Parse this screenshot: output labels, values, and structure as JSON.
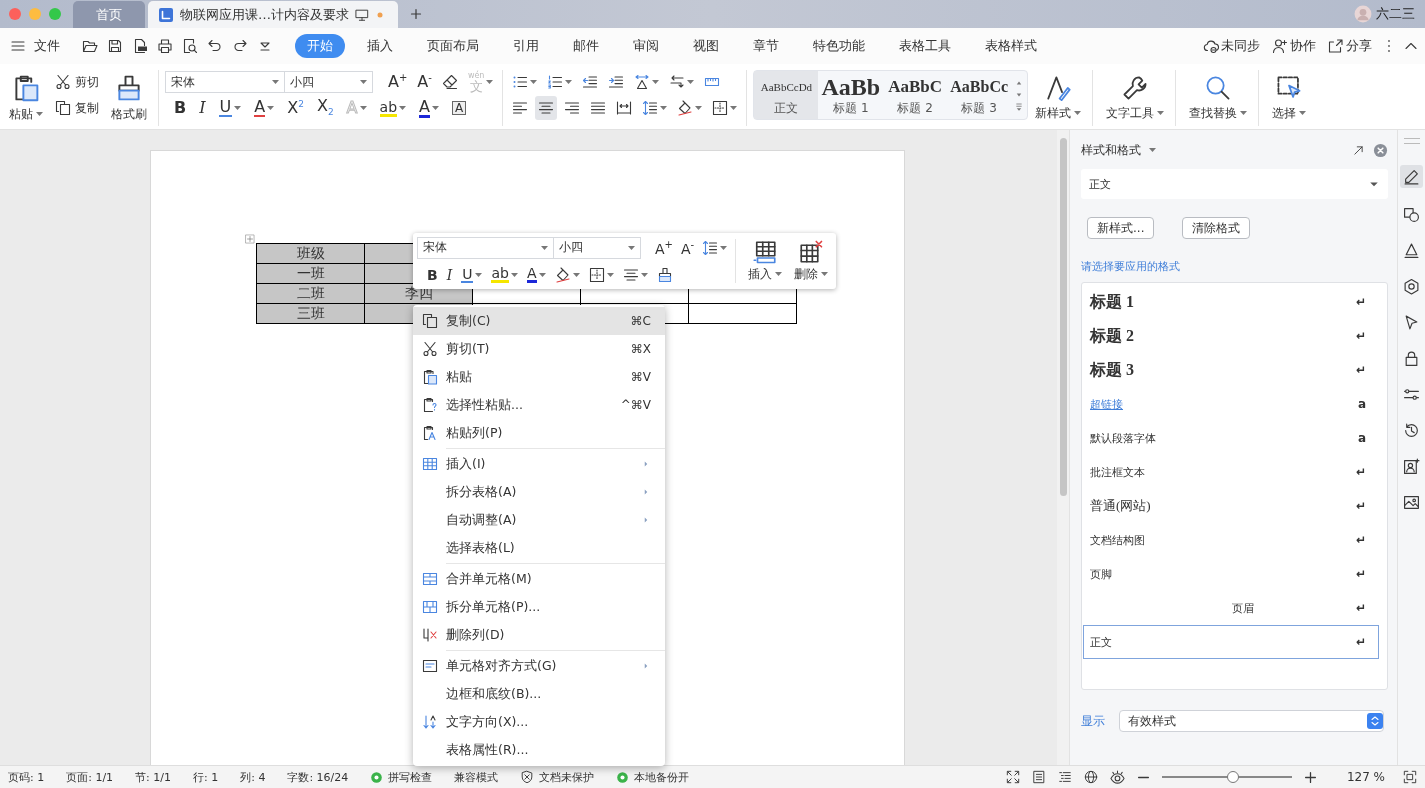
{
  "title_bar": {
    "tabs": [
      {
        "label": "首页",
        "kind": "home",
        "selected": false,
        "unsaved": false
      },
      {
        "label": "物联网应用课…计内容及要求",
        "kind": "document",
        "selected": true,
        "unsaved": true
      }
    ],
    "user": "六二三"
  },
  "menu_bar": {
    "file": "文件",
    "tabs": [
      {
        "label": "开始",
        "selected": true
      },
      {
        "label": "插入",
        "selected": false
      },
      {
        "label": "页面布局",
        "selected": false
      },
      {
        "label": "引用",
        "selected": false
      },
      {
        "label": "邮件",
        "selected": false
      },
      {
        "label": "审阅",
        "selected": false
      },
      {
        "label": "视图",
        "selected": false
      },
      {
        "label": "章节",
        "selected": false
      },
      {
        "label": "特色功能",
        "selected": false
      },
      {
        "label": "表格工具",
        "selected": false
      },
      {
        "label": "表格样式",
        "selected": false
      }
    ],
    "actions": [
      "未同步",
      "协作",
      "分享"
    ]
  },
  "ribbon": {
    "clipboard": {
      "paste": "粘贴",
      "cut": "剪切",
      "copy": "复制",
      "painter": "格式刷"
    },
    "font": {
      "name": "宋体",
      "size": "小四",
      "buttons": [
        {
          "text": "A$^{+}$",
          "kind": "grow",
          "disabled": false
        },
        {
          "text": "A$^{-}$",
          "kind": "shrink",
          "disabled": false
        },
        {
          "text": "文",
          "ruby": "wén",
          "kind": "phonetic",
          "disabled": true
        },
        {
          "text": "B",
          "kind": "bold",
          "disabled": false
        },
        {
          "text": "I",
          "kind": "italic",
          "disabled": false
        },
        {
          "text": "U",
          "kind": "underline",
          "disabled": false
        },
        {
          "text": "A",
          "kind": "strike",
          "disabled": false
        },
        {
          "text": "X$^{2}$",
          "kind": "superscript",
          "disabled": false
        },
        {
          "text": "X$_{2}$",
          "kind": "subscript",
          "disabled": false
        },
        {
          "text": "A",
          "kind": "outline",
          "disabled": true
        },
        {
          "text": "ab",
          "kind": "highlight",
          "disabled": false
        },
        {
          "text": "A",
          "kind": "color",
          "disabled": false
        },
        {
          "text": "A",
          "kind": "charborder",
          "disabled": false
        }
      ]
    },
    "paragraph": {
      "align_buttons": [
        {
          "selected": false
        },
        {
          "selected": true
        },
        {
          "selected": false
        },
        {
          "selected": false
        },
        {
          "selected": false
        }
      ]
    },
    "style_gallery": [
      {
        "preview": "AaBbCcDd",
        "label": "正文",
        "kind": "body",
        "selected": true
      },
      {
        "preview": "AaBb",
        "label": "标题 1",
        "kind": "heading1",
        "selected": false
      },
      {
        "preview": "AaBbC",
        "label": "标题 2",
        "kind": "heading2",
        "selected": false
      },
      {
        "preview": "AaBbCc",
        "label": "标题 3",
        "kind": "heading3",
        "selected": false
      }
    ],
    "tools": [
      "新样式",
      "文字工具",
      "查找替换",
      "选择"
    ]
  },
  "document": {
    "table": {
      "rows": [
        {
          "cells": [
            {
              "text": "班级",
              "shaded": true
            },
            {
              "shaded": true
            }
          ]
        },
        {
          "cells": [
            {
              "text": "一班",
              "shaded": true
            },
            {
              "shaded": true
            }
          ]
        },
        {
          "cells": [
            {
              "text": "二班",
              "shaded": true
            },
            {
              "text": "李四",
              "shaded": true
            },
            {
              "shaded": false
            },
            {
              "shaded": false
            },
            {
              "shaded": false
            }
          ]
        },
        {
          "cells": [
            {
              "text": "三班",
              "shaded": true
            },
            {
              "shaded": true
            },
            {
              "shaded": false
            },
            {
              "shaded": false
            },
            {
              "shaded": false
            }
          ]
        }
      ]
    }
  },
  "mini_toolbar": {
    "font": "宋体",
    "size": "小四",
    "buttons": [
      {
        "text": "A$^{+}$",
        "kind": "grow"
      },
      {
        "text": "A$^{-}$",
        "kind": "shrink"
      },
      {
        "text": "B",
        "kind": "bold"
      },
      {
        "text": "I",
        "kind": "italic"
      },
      {
        "text": "U",
        "kind": "underline"
      },
      {
        "text": "ab",
        "kind": "highlight"
      },
      {
        "text": "A",
        "kind": "color"
      }
    ],
    "insert": "插入",
    "delete": "删除"
  },
  "context_menu": {
    "groups": [
      [
        {
          "label": "复制(C)",
          "shortcut": "⌘C",
          "submenu": false,
          "selected": true
        },
        {
          "label": "剪切(T)",
          "shortcut": "⌘X",
          "submenu": false,
          "selected": false
        },
        {
          "label": "粘贴",
          "shortcut": "⌘V",
          "submenu": false,
          "selected": false
        },
        {
          "label": "选择性粘贴...",
          "shortcut": "^⌘V",
          "submenu": false,
          "selected": false
        },
        {
          "label": "粘贴列(P)",
          "submenu": false,
          "selected": false
        }
      ],
      [
        {
          "label": "插入(I)",
          "submenu": true,
          "selected": false
        },
        {
          "label": "拆分表格(A)",
          "submenu": true,
          "selected": false
        },
        {
          "label": "自动调整(A)",
          "submenu": true,
          "selected": false
        },
        {
          "label": "选择表格(L)",
          "submenu": false,
          "selected": false
        }
      ],
      [
        {
          "label": "合并单元格(M)",
          "submenu": false,
          "selected": false
        },
        {
          "label": "拆分单元格(P)...",
          "submenu": false,
          "selected": false
        },
        {
          "label": "删除列(D)",
          "submenu": false,
          "selected": false
        }
      ],
      [
        {
          "label": "单元格对齐方式(G)",
          "submenu": true,
          "selected": false
        },
        {
          "label": "边框和底纹(B)...",
          "submenu": false,
          "selected": false
        },
        {
          "label": "文字方向(X)...",
          "submenu": false,
          "selected": false
        },
        {
          "label": "表格属性(R)...",
          "submenu": false,
          "selected": false
        }
      ]
    ]
  },
  "styles_panel": {
    "title": "样式和格式",
    "current_style": "正文",
    "buttons": [
      "新样式...",
      "清除格式"
    ],
    "prompt": "请选择要应用的格式",
    "styles": [
      {
        "label": "标题 1",
        "kind": "heading",
        "symbol": "↵",
        "selected": false
      },
      {
        "label": "标题 2",
        "kind": "heading",
        "symbol": "↵",
        "selected": false
      },
      {
        "label": "标题 3",
        "kind": "heading",
        "symbol": "↵",
        "selected": false
      },
      {
        "label": "超链接",
        "kind": "hyperlink",
        "symbol": "a",
        "selected": false
      },
      {
        "label": "默认段落字体",
        "kind": "small",
        "symbol": "a",
        "selected": false
      },
      {
        "label": "批注框文本",
        "kind": "small",
        "symbol": "↵",
        "selected": false
      },
      {
        "label": "普通(网站)",
        "kind": "large",
        "symbol": "↵",
        "selected": false
      },
      {
        "label": "文档结构图",
        "kind": "medium",
        "symbol": "↵",
        "selected": false
      },
      {
        "label": "页脚",
        "kind": "tiny",
        "symbol": "↵",
        "selected": false
      },
      {
        "label": "页眉",
        "kind": "centered",
        "symbol": "↵",
        "selected": false
      },
      {
        "label": "正文",
        "kind": "medium",
        "symbol": "↵",
        "selected": true
      }
    ],
    "show_label": "显示",
    "show_value": "有效样式"
  },
  "status_bar": {
    "items": [
      {
        "text": "页码: 1",
        "kind": "plain"
      },
      {
        "text": "页面: 1/1",
        "kind": "plain"
      },
      {
        "text": "节: 1/1",
        "kind": "plain"
      },
      {
        "text": "行: 1",
        "kind": "plain"
      },
      {
        "text": "列: 4",
        "kind": "plain"
      },
      {
        "text": "字数: 16/24",
        "kind": "plain"
      },
      {
        "text": "拼写检查",
        "kind": "check"
      },
      {
        "text": "兼容模式",
        "kind": "plain"
      },
      {
        "text": "文档未保护",
        "kind": "shield"
      },
      {
        "text": "本地备份开",
        "kind": "check"
      }
    ],
    "zoom": {
      "level": 0.55,
      "reading": "127 %"
    }
  }
}
